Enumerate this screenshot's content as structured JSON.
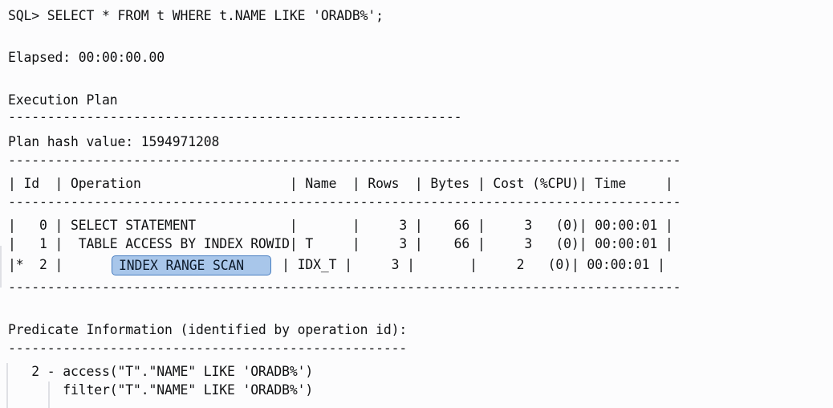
{
  "terminal": {
    "background_color": "#fcfcfd",
    "text_color": "#111214",
    "highlight_bg_color": "#a8c6ea",
    "highlight_border_color": "#4a7fc1",
    "guide_color": "#d9dbe0"
  },
  "query": {
    "prompt": "SQL>",
    "statement": "SQL> SELECT * FROM t WHERE t.NAME LIKE 'ORADB%';"
  },
  "elapsed": {
    "label": "Elapsed: 00:00:00.00"
  },
  "plan": {
    "heading": "Execution Plan",
    "heading_rule": "----------------------------------------------------------",
    "hash_label": "Plan hash value: 1594971208",
    "hash_value": "1594971208",
    "table_rule": "--------------------------------------------------------------------------------------",
    "header_row": "| Id  | Operation                   | Name  | Rows  | Bytes | Cost (%CPU)| Time     |",
    "columns": [
      "Id",
      "Operation",
      "Name",
      "Rows",
      "Bytes",
      "Cost (%CPU)",
      "Time"
    ],
    "rows": [
      {
        "marker": "",
        "id": "0",
        "operation": "SELECT STATEMENT",
        "name": "",
        "rows": "3",
        "bytes": "66",
        "cost": "3",
        "cpu": "(0)",
        "time": "00:00:01",
        "text": "|   0 | SELECT STATEMENT            |       |     3 |    66 |     3   (0)| 00:00:01 |",
        "highlighted": false
      },
      {
        "marker": "",
        "id": "1",
        "operation": "TABLE ACCESS BY INDEX ROWID",
        "name": "T",
        "rows": "3",
        "bytes": "66",
        "cost": "3",
        "cpu": "(0)",
        "time": "00:00:01",
        "text": "|   1 |  TABLE ACCESS BY INDEX ROWID| T     |     3 |    66 |     3   (0)| 00:00:01 |",
        "highlighted": false
      },
      {
        "marker": "*",
        "id": "2",
        "operation": "INDEX RANGE SCAN",
        "name": "IDX_T",
        "rows": "3",
        "bytes": "",
        "cost": "2",
        "cpu": "(0)",
        "time": "00:00:01",
        "text_prefix": "|*  2 |   ",
        "highlight_text": "INDEX RANGE SCAN",
        "text_suffix": "         | IDX_T |     3 |       |     2   (0)| 00:00:01 |",
        "highlighted": true
      }
    ]
  },
  "predicate": {
    "heading": "Predicate Information (identified by operation id):",
    "rule": "---------------------------------------------------",
    "entries": [
      "   2 - access(\"T\".\"NAME\" LIKE 'ORADB%')",
      "       filter(\"T\".\"NAME\" LIKE 'ORADB%')"
    ]
  }
}
